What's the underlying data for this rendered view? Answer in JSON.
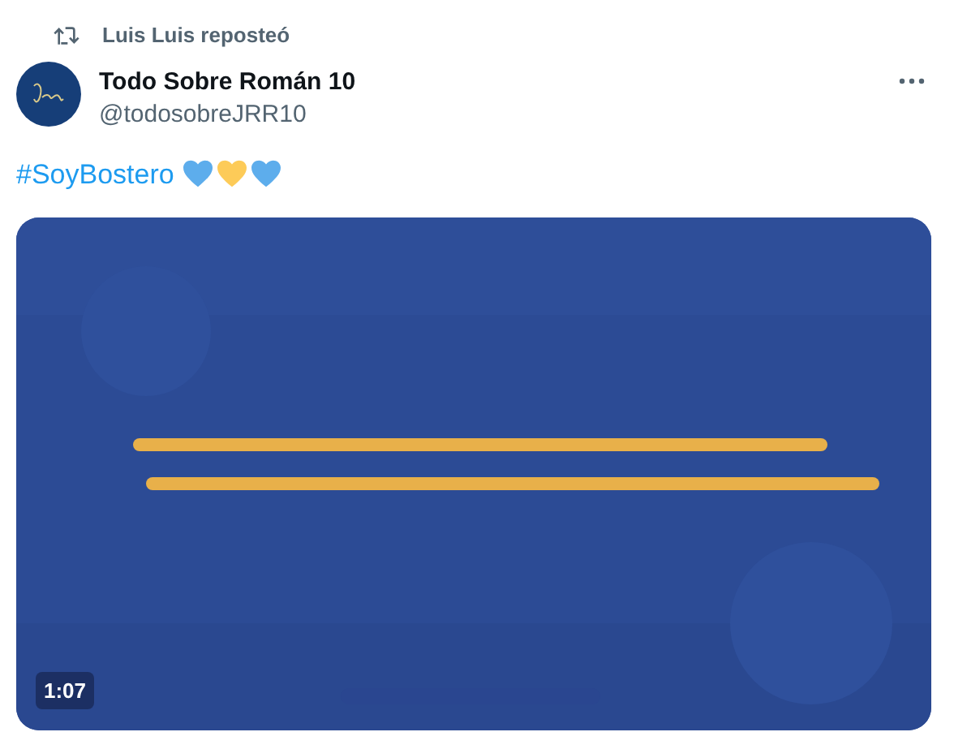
{
  "repost": {
    "text": "Luis Luis reposteó"
  },
  "author": {
    "name": "Todo Sobre Román 10",
    "handle": "@todosobreJRR10"
  },
  "post": {
    "hashtag": "#SoyBostero",
    "hearts": [
      {
        "color": "#5dadec"
      },
      {
        "color": "#fdcb58"
      },
      {
        "color": "#5dadec"
      }
    ]
  },
  "media": {
    "kind": "picture",
    "duration": "1:07"
  }
}
